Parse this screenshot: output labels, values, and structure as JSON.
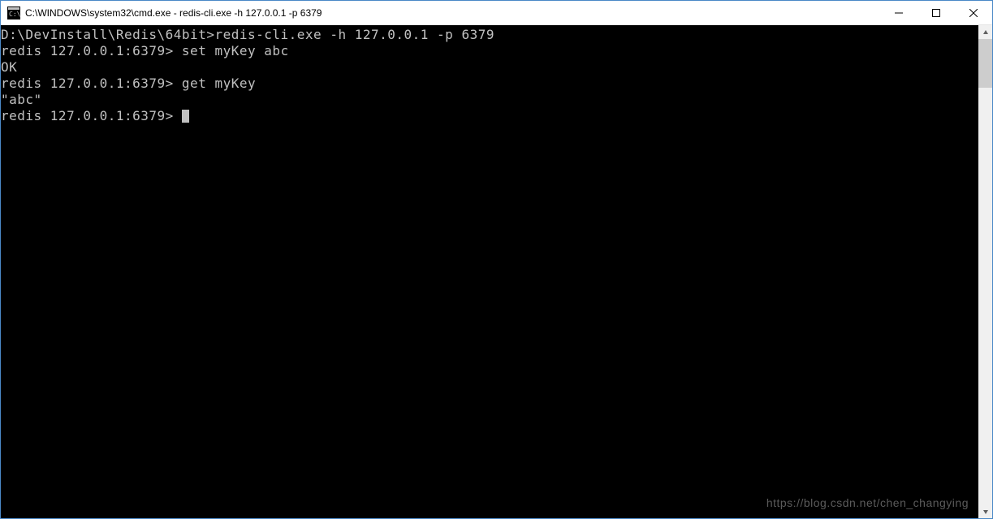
{
  "titlebar": {
    "title": "C:\\WINDOWS\\system32\\cmd.exe - redis-cli.exe  -h 127.0.0.1 -p 6379"
  },
  "terminal": {
    "lines": [
      {
        "prompt": "D:\\DevInstall\\Redis\\64bit>",
        "cmd": "redis-cli.exe -h 127.0.0.1 -p 6379"
      },
      {
        "prompt": "redis 127.0.0.1:6379>",
        "cmd": " set myKey abc"
      },
      {
        "output": "OK"
      },
      {
        "prompt": "redis 127.0.0.1:6379>",
        "cmd": " get myKey"
      },
      {
        "output": "\"abc\""
      },
      {
        "prompt": "redis 127.0.0.1:6379>",
        "cmd": " ",
        "cursor": true
      }
    ]
  },
  "watermark": "https://blog.csdn.net/chen_changying"
}
